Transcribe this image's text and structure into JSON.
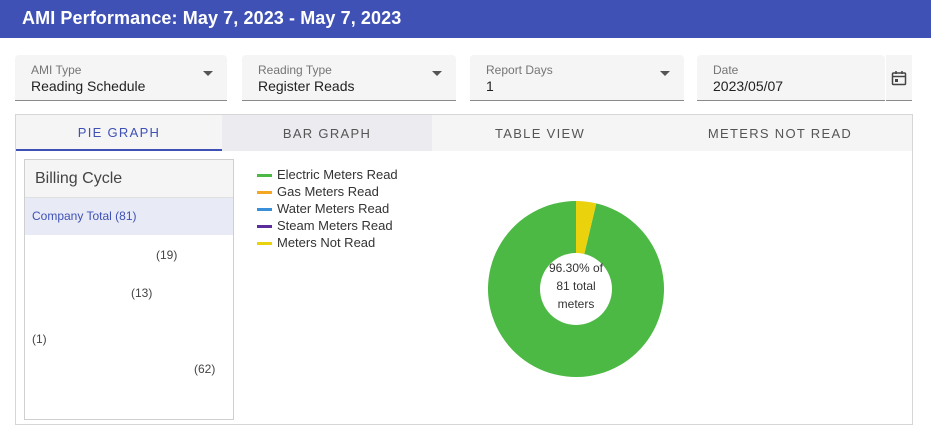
{
  "header": {
    "title": "AMI Performance: May 7, 2023 - May 7, 2023"
  },
  "filters": [
    {
      "label": "AMI Type",
      "value": "Reading Schedule"
    },
    {
      "label": "Reading Type",
      "value": "Register Reads"
    },
    {
      "label": "Report Days",
      "value": "1"
    },
    {
      "label": "Date",
      "value": "2023/05/07"
    }
  ],
  "tabs": [
    "PIE GRAPH",
    "BAR GRAPH",
    "TABLE VIEW",
    "METERS NOT READ"
  ],
  "billing": {
    "title": "Billing Cycle",
    "items": [
      "Company Total (81)",
      "(19)",
      "(13)",
      "(1)",
      "(62)"
    ]
  },
  "legend": [
    {
      "label": "Electric Meters Read",
      "color": "#4cb944"
    },
    {
      "label": "Gas Meters Read",
      "color": "#f5a623"
    },
    {
      "label": "Water Meters Read",
      "color": "#3a8fd9"
    },
    {
      "label": "Steam Meters Read",
      "color": "#5b2d9c"
    },
    {
      "label": "Meters Not Read",
      "color": "#ead20c"
    }
  ],
  "chart_data": {
    "type": "pie",
    "center_text": [
      "96.30% of",
      "81 total",
      "meters"
    ],
    "slices": [
      {
        "name": "Electric Meters Read",
        "value": 78,
        "color": "#4cb944"
      },
      {
        "name": "Meters Not Read",
        "value": 3,
        "color": "#ead20c"
      }
    ]
  }
}
